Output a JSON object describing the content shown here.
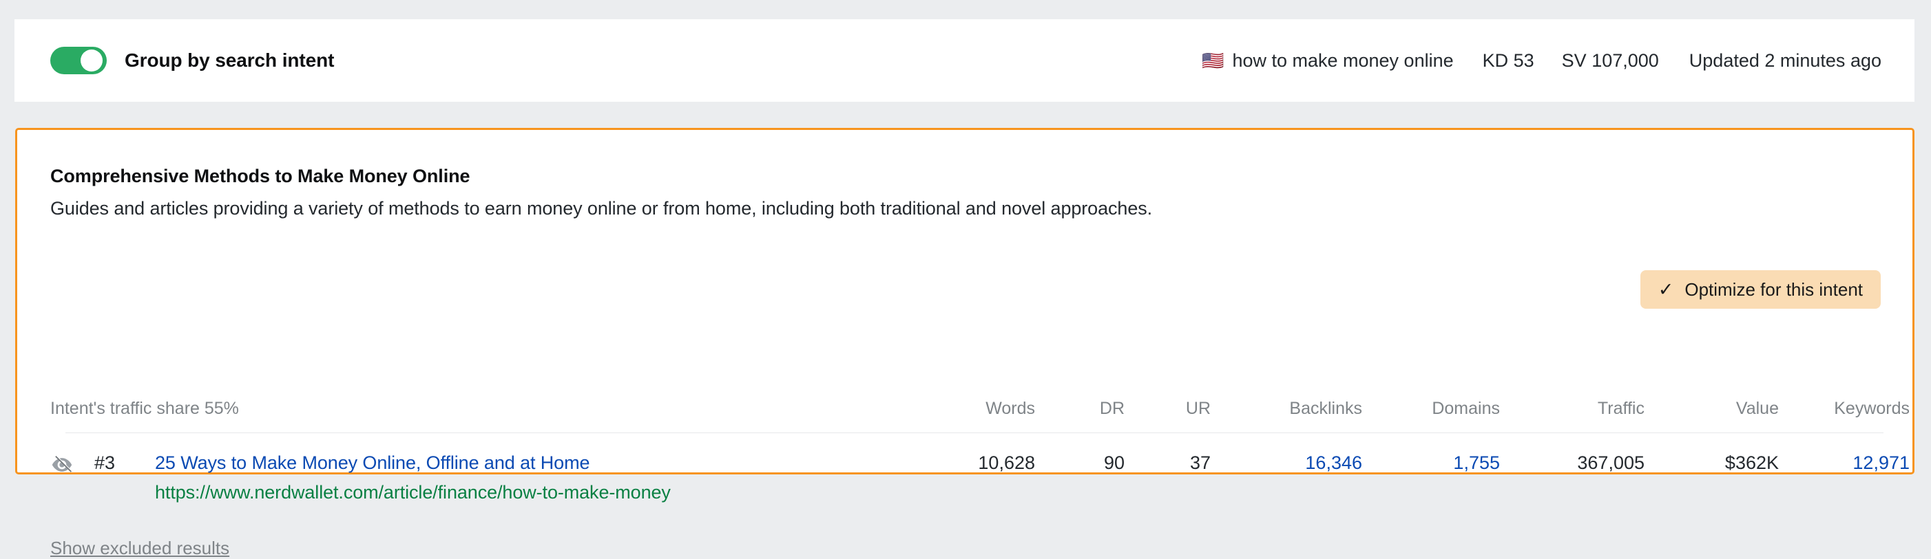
{
  "topbar": {
    "toggle": {
      "label": "Group by search intent",
      "state": "on",
      "color": "#2aab63"
    },
    "keyword": {
      "flag": "🇺🇸",
      "term": "how to make money online",
      "kd": "KD 53",
      "sv": "SV 107,000",
      "updated": "Updated 2 minutes ago"
    }
  },
  "intent_card": {
    "border_color": "#f7941e",
    "title": "Comprehensive Methods to Make Money Online",
    "description": "Guides and articles providing a variety of methods to earn money online or from home, including both traditional and novel approaches.",
    "optimize_button": {
      "label": "Optimize for this intent",
      "icon": "check-icon",
      "bg": "#fadcb4"
    },
    "traffic_share_label": "Intent's traffic share 55%",
    "columns": {
      "words": "Words",
      "dr": "DR",
      "ur": "UR",
      "backlinks": "Backlinks",
      "domains": "Domains",
      "traffic": "Traffic",
      "value": "Value",
      "keywords": "Keywords"
    },
    "rows": [
      {
        "hide_icon": "eye-off-icon",
        "rank": "#3",
        "title": "25 Ways to Make Money Online, Offline and at Home",
        "url": "https://www.nerdwallet.com/article/finance/how-to-make-money",
        "words": "10,628",
        "dr": "90",
        "ur": "37",
        "backlinks": "16,346",
        "domains": "1,755",
        "traffic": "367,005",
        "value": "$362K",
        "keywords": "12,971"
      }
    ],
    "show_excluded_label": "Show excluded results"
  }
}
